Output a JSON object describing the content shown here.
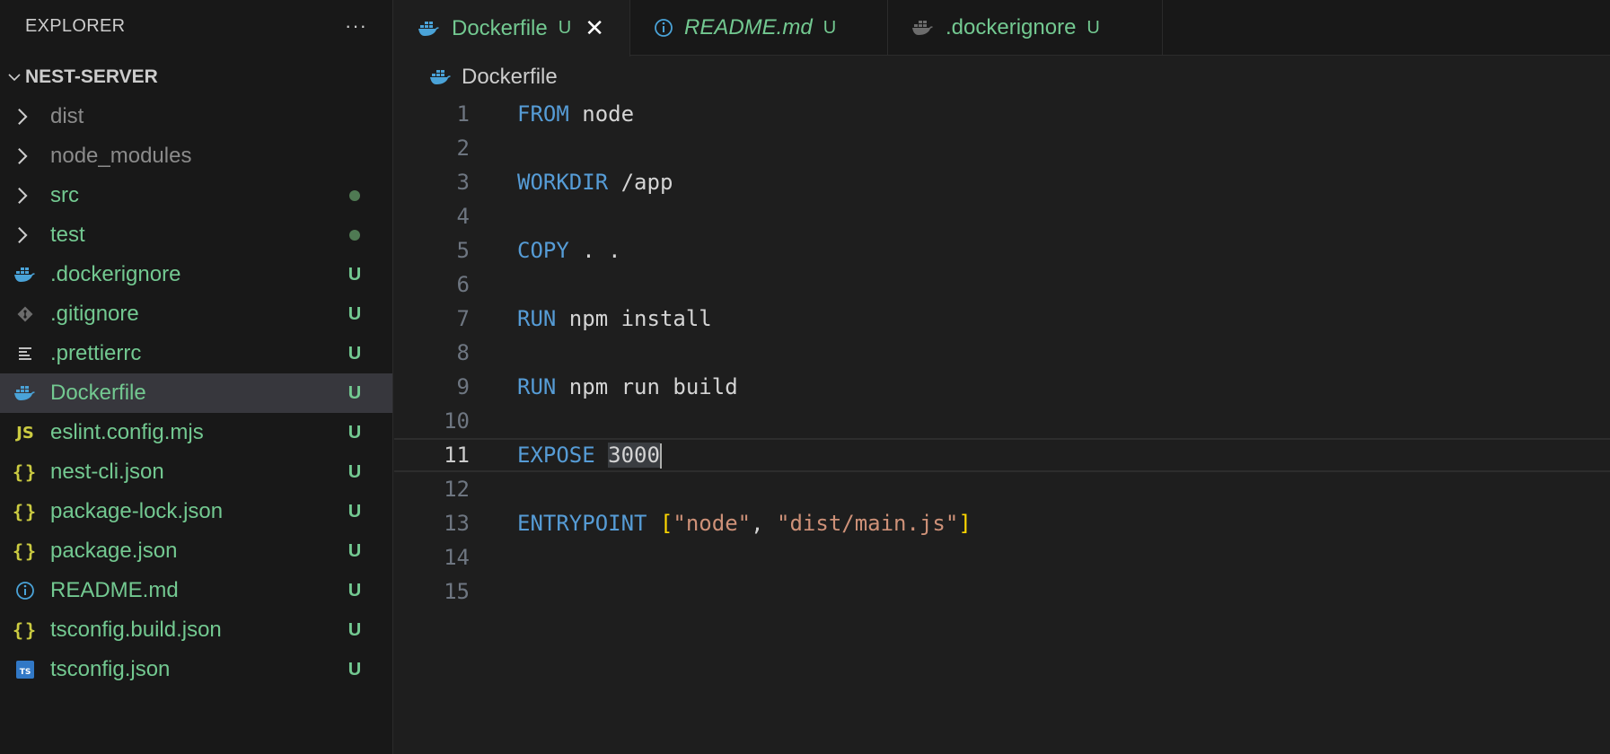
{
  "sidebar": {
    "title": "EXPLORER",
    "more": "···",
    "root": "NEST-SERVER",
    "items": [
      {
        "name": "dist",
        "type": "folder",
        "color": "gray",
        "status": "",
        "dot": false
      },
      {
        "name": "node_modules",
        "type": "folder",
        "color": "gray",
        "status": "",
        "dot": false
      },
      {
        "name": "src",
        "type": "folder",
        "color": "green",
        "status": "",
        "dot": true
      },
      {
        "name": "test",
        "type": "folder",
        "color": "green",
        "status": "",
        "dot": true
      },
      {
        "name": ".dockerignore",
        "type": "file",
        "icon": "docker-icon",
        "color": "green",
        "status": "U"
      },
      {
        "name": ".gitignore",
        "type": "file",
        "icon": "git-icon",
        "color": "green",
        "status": "U"
      },
      {
        "name": ".prettierrc",
        "type": "file",
        "icon": "lines-icon",
        "color": "green",
        "status": "U"
      },
      {
        "name": "Dockerfile",
        "type": "file",
        "icon": "docker-icon",
        "color": "green",
        "status": "U",
        "selected": true
      },
      {
        "name": "eslint.config.mjs",
        "type": "file",
        "icon": "js-icon",
        "icon_text": "JS",
        "color": "green",
        "status": "U"
      },
      {
        "name": "nest-cli.json",
        "type": "file",
        "icon": "json-icon",
        "icon_text": "{}",
        "color": "green",
        "status": "U"
      },
      {
        "name": "package-lock.json",
        "type": "file",
        "icon": "json-icon",
        "icon_text": "{}",
        "color": "green",
        "status": "U"
      },
      {
        "name": "package.json",
        "type": "file",
        "icon": "json-icon",
        "icon_text": "{}",
        "color": "green",
        "status": "U"
      },
      {
        "name": "README.md",
        "type": "file",
        "icon": "info-icon",
        "color": "green",
        "status": "U"
      },
      {
        "name": "tsconfig.build.json",
        "type": "file",
        "icon": "json-icon",
        "icon_text": "{}",
        "color": "green",
        "status": "U"
      },
      {
        "name": "tsconfig.json",
        "type": "file",
        "icon": "ts-icon",
        "icon_text": "TS",
        "color": "green",
        "status": "U"
      }
    ]
  },
  "tabs": [
    {
      "label": "Dockerfile",
      "status": "U",
      "icon": "docker-icon",
      "active": true,
      "italic": false,
      "close": "✕"
    },
    {
      "label": "README.md",
      "status": "U",
      "icon": "info-icon",
      "active": false,
      "italic": true
    },
    {
      "label": ".dockerignore",
      "status": "U",
      "icon": "docker-icon",
      "active": false,
      "italic": false
    }
  ],
  "breadcrumb": {
    "file": "Dockerfile"
  },
  "editor": {
    "current_line": 11,
    "lines": [
      {
        "n": "1",
        "tokens": [
          [
            "kw",
            "FROM"
          ],
          [
            "pl",
            " node"
          ]
        ]
      },
      {
        "n": "2",
        "tokens": []
      },
      {
        "n": "3",
        "tokens": [
          [
            "kw",
            "WORKDIR"
          ],
          [
            "pl",
            " /app"
          ]
        ]
      },
      {
        "n": "4",
        "tokens": []
      },
      {
        "n": "5",
        "tokens": [
          [
            "kw",
            "COPY"
          ],
          [
            "pl",
            " . ."
          ]
        ]
      },
      {
        "n": "6",
        "tokens": []
      },
      {
        "n": "7",
        "tokens": [
          [
            "kw",
            "RUN"
          ],
          [
            "pl",
            " npm install"
          ]
        ]
      },
      {
        "n": "8",
        "tokens": []
      },
      {
        "n": "9",
        "tokens": [
          [
            "kw",
            "RUN"
          ],
          [
            "pl",
            " npm run build"
          ]
        ]
      },
      {
        "n": "10",
        "tokens": []
      },
      {
        "n": "11",
        "tokens": [
          [
            "kw",
            "EXPOSE"
          ],
          [
            "pl",
            " "
          ],
          [
            "sel",
            "3000"
          ]
        ]
      },
      {
        "n": "12",
        "tokens": []
      },
      {
        "n": "13",
        "tokens": [
          [
            "kw",
            "ENTRYPOINT"
          ],
          [
            "pl",
            " "
          ],
          [
            "br",
            "["
          ],
          [
            "str",
            "\"node\""
          ],
          [
            "pl",
            ", "
          ],
          [
            "str",
            "\"dist/main.js\""
          ],
          [
            "br",
            "]"
          ]
        ]
      },
      {
        "n": "14",
        "tokens": []
      },
      {
        "n": "15",
        "tokens": []
      }
    ]
  },
  "colors": {
    "accent_green": "#73c991",
    "keyword_blue": "#569cd6",
    "string_orange": "#ce9178",
    "bracket_gold": "#ffd700",
    "docker_blue": "#4aa3d8",
    "json_yellow": "#cbcb41"
  }
}
